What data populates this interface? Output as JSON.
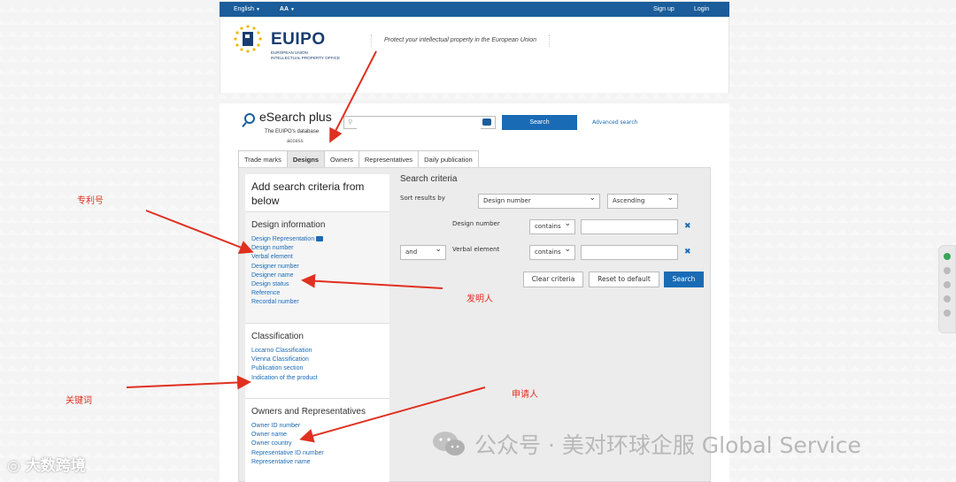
{
  "topbar": {
    "language": "English",
    "text_size": "AA",
    "sign_up": "Sign up",
    "login": "Login"
  },
  "header": {
    "logo_name": "EUIPO",
    "logo_subtitle_1": "EUROPEAN UNION",
    "logo_subtitle_2": "INTELLECTUAL PROPERTY OFFICE",
    "tagline": "Protect your intellectual property in the European Union"
  },
  "esearch": {
    "title": "eSearch plus",
    "subtitle": "The EUIPO's database",
    "subtitle2": "access",
    "search_placeholder": "",
    "search_button": "Search",
    "advanced_link": "Advanced search"
  },
  "tabs": [
    {
      "label": "Trade marks",
      "active": false
    },
    {
      "label": "Designs",
      "active": true
    },
    {
      "label": "Owners",
      "active": false
    },
    {
      "label": "Representatives",
      "active": false
    },
    {
      "label": "Daily publication",
      "active": false
    }
  ],
  "left_panel": {
    "heading": "Add search criteria from below",
    "sections": [
      {
        "title": "Design information",
        "links": [
          "Design Representation",
          "Design number",
          "Verbal element",
          "Designer number",
          "Designer name",
          "Design status",
          "Reference",
          "Recordal number"
        ]
      },
      {
        "title": "Classification",
        "links": [
          "Locarno Classification",
          "Vienna Classification",
          "Publication section",
          "Indication of the product"
        ]
      },
      {
        "title": "Owners and Representatives",
        "links": [
          "Owner ID number",
          "Owner name",
          "Owner country",
          "Representative ID number",
          "Representative name"
        ]
      }
    ]
  },
  "criteria": {
    "title": "Search criteria",
    "sort_label": "Sort results by",
    "sort_field": "Design number",
    "sort_order": "Ascending",
    "row1_label": "Design number",
    "row1_operator": "contains",
    "row1_value": "",
    "row2_connector": "and",
    "row2_label": "Verbal element",
    "row2_operator": "contains",
    "row2_value": "",
    "clear_button": "Clear criteria",
    "reset_button": "Reset to default",
    "search_button": "Search"
  },
  "annotations": {
    "patent_number": "专利号",
    "inventor": "发明人",
    "keyword": "关键词",
    "applicant": "申请人"
  },
  "watermarks": {
    "wechat": "公众号 · 美对环球企服 Global Service",
    "brand": "大数跨境"
  },
  "colors": {
    "topbar": "#1a5d9a",
    "link": "#1a6bb5",
    "annotation": "#e03020"
  }
}
